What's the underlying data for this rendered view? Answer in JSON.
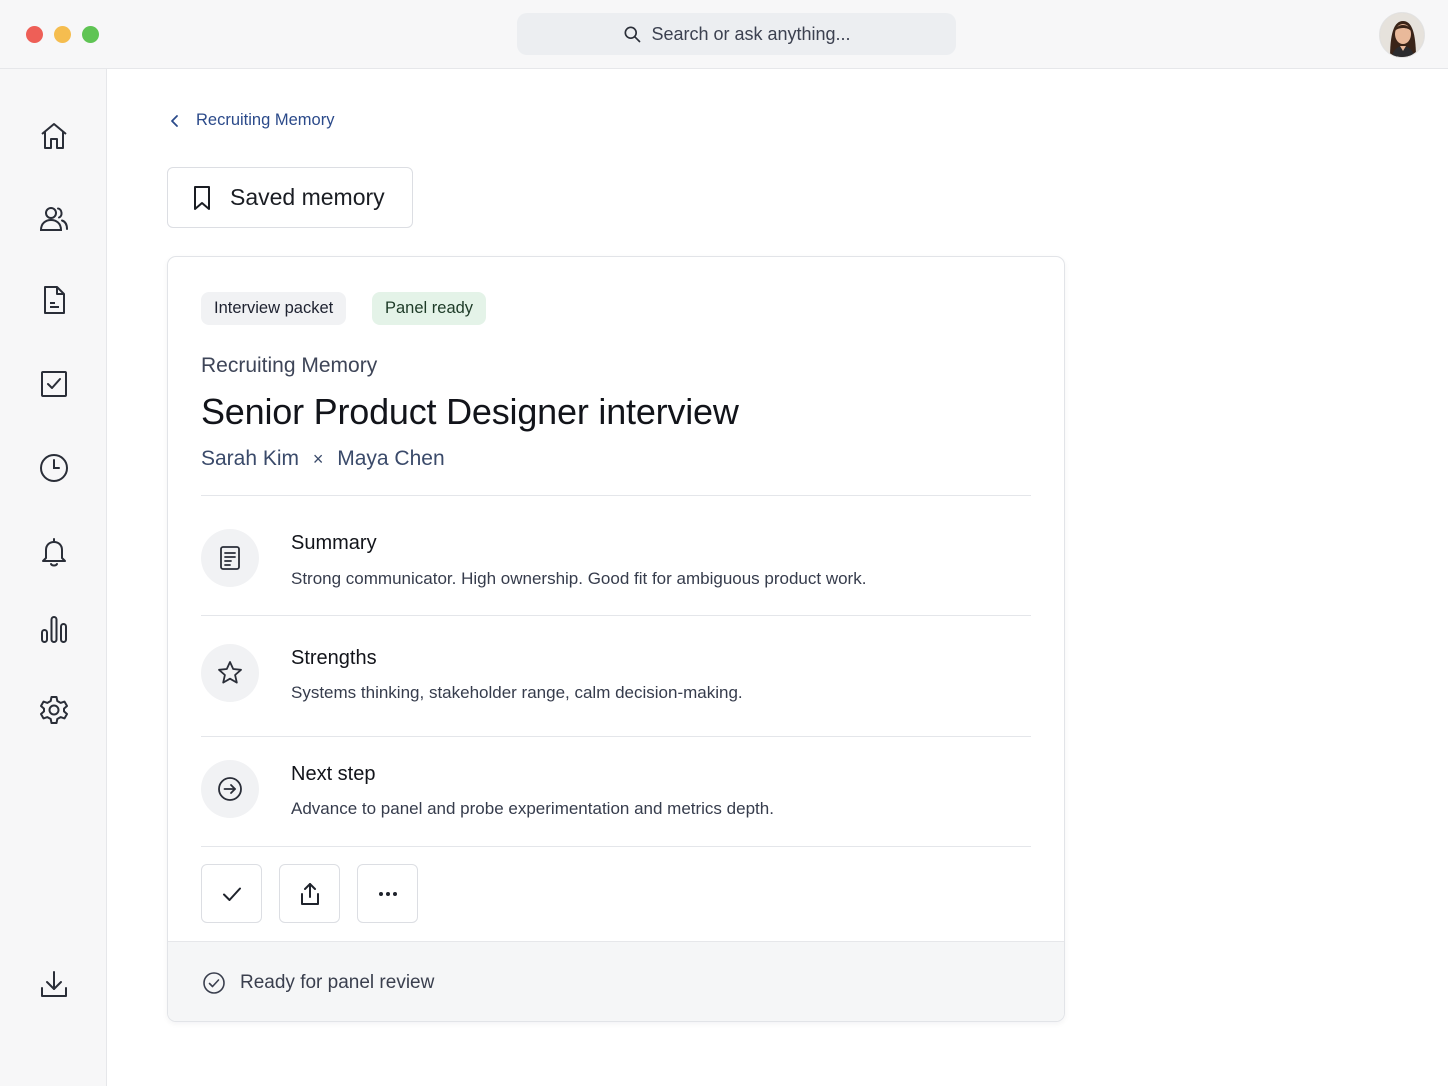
{
  "search": {
    "placeholder": "Search or ask anything..."
  },
  "sidebar": {
    "icons": [
      "home-icon",
      "people-icon",
      "document-icon",
      "checkbox-icon",
      "clock-icon",
      "bell-icon",
      "bar-chart-icon",
      "gear-icon",
      "download-icon"
    ]
  },
  "breadcrumb": {
    "label": "Recruiting Memory"
  },
  "saved_button": {
    "label": "Saved memory"
  },
  "card": {
    "tags": [
      "Interview packet",
      "Panel ready"
    ],
    "eyebrow": "Recruiting Memory",
    "title": "Senior Product Designer interview",
    "candidate": "Sarah Kim",
    "separator": "×",
    "interviewer": "Maya Chen",
    "sections": [
      {
        "title": "Summary",
        "text": "Strong communicator. High ownership. Good fit for ambiguous product work.",
        "icon": "notes-icon"
      },
      {
        "title": "Strengths",
        "text": "Systems thinking, stakeholder range, calm decision-making.",
        "icon": "star-icon"
      },
      {
        "title": "Next step",
        "text": "Advance to panel and probe experimentation and metrics depth.",
        "icon": "arrow-right-circle-icon"
      }
    ],
    "actions": [
      "check-icon",
      "share-icon",
      "more-icon"
    ],
    "status": "Ready for panel review"
  },
  "colors": {
    "accent": "#2b4a8a",
    "tag_green": "#e4f3e8",
    "tag_gray": "#f1f2f4"
  }
}
